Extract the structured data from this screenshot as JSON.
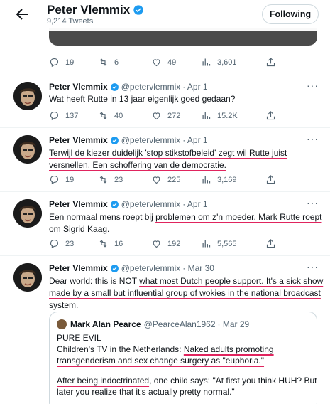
{
  "header": {
    "name": "Peter Vlemmix",
    "tweet_count": "9,214 Tweets",
    "follow_label": "Following"
  },
  "top_actions": {
    "replies": "19",
    "retweets": "6",
    "likes": "49",
    "views": "3,601"
  },
  "tweets": [
    {
      "name": "Peter Vlemmix",
      "handle": "@petervlemmix",
      "date": "· Apr 1",
      "text": "Wat heeft Rutte in 13 jaar eigenlijk goed gedaan?",
      "replies": "137",
      "retweets": "40",
      "likes": "272",
      "views": "15.2K"
    },
    {
      "name": "Peter Vlemmix",
      "handle": "@petervlemmix",
      "date": "· Apr 1",
      "text_line1": "Terwijl de kiezer duidelijk 'stop stikstofbeleid' zegt wil Rutte juist",
      "text_line2": "versnellen. Een schoffering van de democratie.",
      "replies": "19",
      "retweets": "23",
      "likes": "225",
      "views": "3,169"
    },
    {
      "name": "Peter Vlemmix",
      "handle": "@petervlemmix",
      "date": "· Apr 1",
      "text_a": "Een normaal mens roept bij ",
      "text_b": "problemen om z'n moeder. Mark Rutte roept",
      "text_line2": "om Sigrid Kaag.",
      "replies": "23",
      "retweets": "16",
      "likes": "192",
      "views": "5,565"
    },
    {
      "name": "Peter Vlemmix",
      "handle": "@petervlemmix",
      "date": "· Mar 30",
      "text_a": "Dear world: this is NOT ",
      "text_b": "what most Dutch people support. It's a sick show",
      "text_line2": "made by a small but influential group of wokies in the national broadcast",
      "text_line3": "system.",
      "quote": {
        "name": "Mark Alan Pearce",
        "handle": "@PearceAlan1962",
        "date": "· Mar 29",
        "line1": "PURE EVIL",
        "line2a": "Children's TV in the Netherlands: ",
        "line2b": "Naked adults promoting",
        "line3": "transgenderism and sex change surgery as \"euphoria.\"",
        "line4a": "After being indoctrinated",
        "line4b": ", one child says: \"At first you think HUH? But",
        "line5": "later you realize that it's actually pretty normal.\""
      }
    }
  ],
  "colors": {
    "verified": "#1d9bf0",
    "underline": "#e0245e",
    "muted": "#536471"
  },
  "icons": [
    "back-arrow-icon",
    "verified-badge-icon",
    "more-icon",
    "reply-icon",
    "retweet-icon",
    "like-icon",
    "views-icon",
    "share-icon"
  ]
}
